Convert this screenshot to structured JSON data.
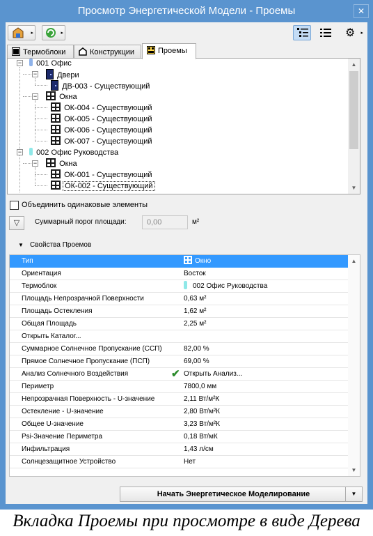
{
  "window": {
    "title": "Просмотр Энергетической Модели - Проемы",
    "close_glyph": "✕"
  },
  "toolbar": {
    "arrow": "▸",
    "tree_view_icon": "tree-list-icon",
    "list_view_icon": "list-icon",
    "settings_icon": "gear-icon",
    "settings_glyph": "⚙"
  },
  "tabs": [
    {
      "label": "Термоблоки",
      "icon": "thermal-blocks-icon"
    },
    {
      "label": "Конструкции",
      "icon": "structures-icon"
    },
    {
      "label": "Проемы",
      "icon": "openings-icon",
      "active": true
    }
  ],
  "tree": {
    "expand_glyph": "−",
    "zones": [
      {
        "label": "001 Офис",
        "color": "#8fb3ea"
      },
      {
        "label": "002 Офис Руководства",
        "color": "#8fe8e8"
      }
    ],
    "group_doors": "Двери",
    "group_windows": "Окна",
    "items_office_doors": [
      "ДВ-003 - Существующий"
    ],
    "items_office_windows": [
      "ОК-004 - Существующий",
      "ОК-005 - Существующий",
      "ОК-006 - Существующий",
      "ОК-007 - Существующий"
    ],
    "group_windows_2": "Окна",
    "items_exec_windows": [
      "ОК-001 - Существующий",
      "ОК-002 - Существующий"
    ],
    "selected_item": "ОК-002 - Существующий"
  },
  "scroll": {
    "up": "▲",
    "down": "▼"
  },
  "merge_checkbox": {
    "label": "Объединить одинаковые элементы",
    "checked": false
  },
  "filter": {
    "icon": "filter-icon",
    "glyph": "▽",
    "threshold_label": "Суммарный порог площади:",
    "threshold_value": "0,00",
    "unit": "м²"
  },
  "properties": {
    "header": "Свойства Проемов",
    "collapse_glyph": "▼",
    "rows": [
      {
        "name": "Тип",
        "value": "Окно",
        "icon": "window-icon",
        "selected": true
      },
      {
        "name": "Ориентация",
        "value": "Восток"
      },
      {
        "name": "Термоблок",
        "value": "002 Офис Руководства",
        "swatch": "#8fe8e8"
      },
      {
        "name": "Площадь Непрозрачной Поверхности",
        "value": "0,63 м²"
      },
      {
        "name": "Площадь Остекления",
        "value": "1,62 м²"
      },
      {
        "name": "Общая Площадь",
        "value": "2,25 м²"
      },
      {
        "name": "Открыть Каталог...",
        "value": ""
      },
      {
        "name": "Суммарное Солнечное Пропускание (ССП)",
        "value": "82,00 %"
      },
      {
        "name": "Прямое Солнечное Пропускание (ПСП)",
        "value": "69,00 %"
      },
      {
        "name": "Анализ Солнечного Воздействия",
        "value": "Открыть Анализ...",
        "check": "✔"
      },
      {
        "name": "Периметр",
        "value": "7800,0 мм"
      },
      {
        "name": "Непрозрачная Поверхность - U-значение",
        "value": "2,11 Вт/м²К"
      },
      {
        "name": "Остекление - U-значение",
        "value": "2,80 Вт/м²К"
      },
      {
        "name": "Общее U-значение",
        "value": "3,23 Вт/м²К"
      },
      {
        "name": "Psi-Значение Периметра",
        "value": "0,18 Вт/мК"
      },
      {
        "name": "Инфильтрация",
        "value": "1,43 л/см"
      },
      {
        "name": "Солнцезащитное Устройство",
        "value": "Нет"
      }
    ]
  },
  "start_button": {
    "label": "Начать Энергетическое Моделирование",
    "dropdown_glyph": "▼"
  },
  "caption": "Вкладка Проемы при просмотре в виде Дерева"
}
